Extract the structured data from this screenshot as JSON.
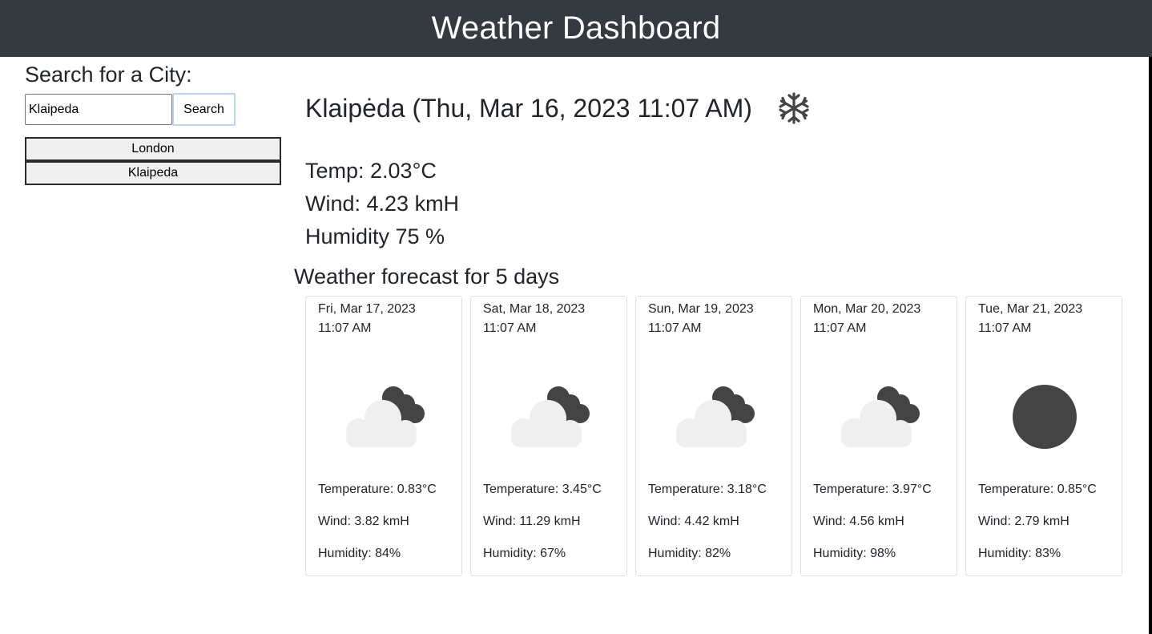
{
  "header": {
    "title": "Weather Dashboard"
  },
  "sidebar": {
    "title": "Search for a City:",
    "search": {
      "value": "Klaipeda",
      "placeholder": "",
      "button_label": "Search"
    },
    "history": [
      {
        "label": "London"
      },
      {
        "label": "Klaipeda"
      }
    ]
  },
  "current": {
    "title": "Klaipėda (Thu, Mar 16, 2023 11:07 AM)",
    "icon": "snowflake-icon",
    "temp": "Temp: 2.03°C",
    "wind": "Wind: 4.23 kmH",
    "humidity": "Humidity 75 %"
  },
  "forecast": {
    "title": "Weather forecast for 5 days",
    "days": [
      {
        "date": "Fri, Mar 17, 2023 11:07 AM",
        "icon": "cloud-icon",
        "temp": "Temperature: 0.83°C",
        "wind": "Wind: 3.82 kmH",
        "humidity": "Humidity: 84%"
      },
      {
        "date": "Sat, Mar 18, 2023 11:07 AM",
        "icon": "cloud-icon",
        "temp": "Temperature: 3.45°C",
        "wind": "Wind: 11.29 kmH",
        "humidity": "Humidity: 67%"
      },
      {
        "date": "Sun, Mar 19, 2023 11:07 AM",
        "icon": "cloud-icon",
        "temp": "Temperature: 3.18°C",
        "wind": "Wind: 4.42 kmH",
        "humidity": "Humidity: 82%"
      },
      {
        "date": "Mon, Mar 20, 2023 11:07 AM",
        "icon": "cloud-icon",
        "temp": "Temperature: 3.97°C",
        "wind": "Wind: 4.56 kmH",
        "humidity": "Humidity: 98%"
      },
      {
        "date": "Tue, Mar 21, 2023 11:07 AM",
        "icon": "circle-icon",
        "temp": "Temperature: 0.85°C",
        "wind": "Wind: 2.79 kmH",
        "humidity": "Humidity: 83%"
      }
    ]
  },
  "colors": {
    "header_bg": "#343a40",
    "icon_dark": "#444444",
    "icon_light": "#efefef"
  }
}
